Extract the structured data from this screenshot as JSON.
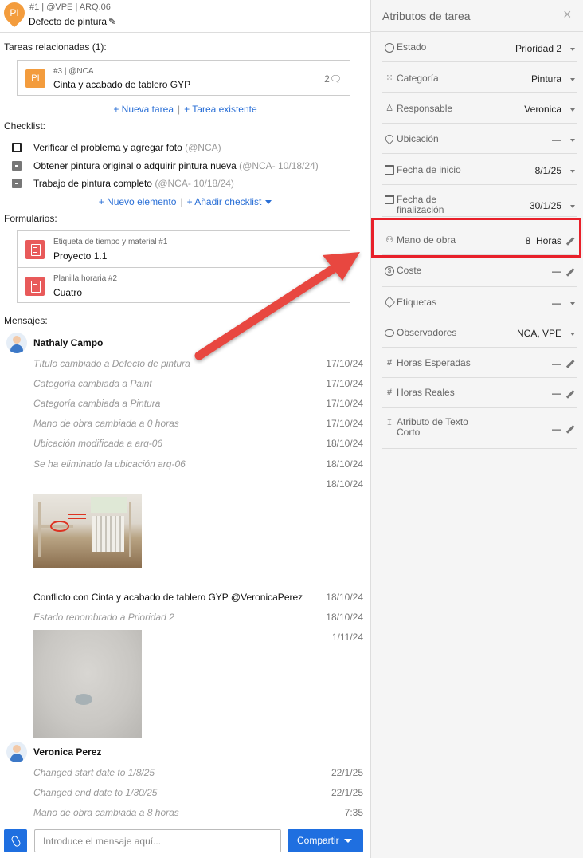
{
  "task": {
    "badge": "PI",
    "meta": "#1 | @VPE | ARQ.06",
    "title": "Defecto de pintura"
  },
  "related": {
    "label": "Tareas relacionadas (1):",
    "items": [
      {
        "badge": "PI",
        "meta": "#3 | @NCA",
        "name": "Cinta y acabado de tablero GYP",
        "comments": "2"
      }
    ],
    "new_task": "+ Nueva tarea",
    "existing_task": "+ Tarea existente"
  },
  "checklist": {
    "label": "Checklist:",
    "items": [
      {
        "text": "Verificar el problema y agregar foto",
        "note": "(@NCA)",
        "state": "unchecked"
      },
      {
        "text": "Obtener pintura original o adquirir pintura nueva",
        "note": "(@NCA- 10/18/24)",
        "state": "partial"
      },
      {
        "text": "Trabajo de pintura completo",
        "note": "(@NCA- 10/18/24)",
        "state": "partial"
      }
    ],
    "new_item": "+ Nuevo elemento",
    "add_checklist": "+ Añadir checklist"
  },
  "forms": {
    "label": "Formularios:",
    "items": [
      {
        "label": "Etiqueta de tiempo y material #1",
        "value": "Proyecto 1.1"
      },
      {
        "label": "Planilla horaria #2",
        "value": "Cuatro"
      }
    ]
  },
  "messages": {
    "label": "Mensajes:",
    "groups": [
      {
        "author": "Nathaly Campo",
        "entries": [
          {
            "text": "Título cambiado a Defecto de pintura",
            "date": "17/10/24"
          },
          {
            "text": "Categoría cambiada a Paint",
            "date": "17/10/24"
          },
          {
            "text": "Categoría cambiada a Pintura",
            "date": "17/10/24"
          },
          {
            "text": "Mano de obra cambiada a 0 horas",
            "date": "17/10/24"
          },
          {
            "text": "Ubicación modificada a arq-06",
            "date": "18/10/24"
          },
          {
            "text": "Se ha eliminado la ubicación arq-06",
            "date": "18/10/24"
          },
          {
            "text": "",
            "date": "18/10/24"
          },
          {
            "text": "Conflicto con Cinta y acabado de tablero GYP @VeronicaPerez",
            "date": "18/10/24"
          },
          {
            "text": "Estado renombrado a Prioridad 2",
            "date": "18/10/24"
          },
          {
            "text": "",
            "date": "1/11/24"
          }
        ]
      },
      {
        "author": "Veronica Perez",
        "entries": [
          {
            "text": "Changed start date to 1/8/25",
            "date": "22/1/25"
          },
          {
            "text": "Changed end date to 1/30/25",
            "date": "22/1/25"
          },
          {
            "text": "Mano de obra cambiada a 8 horas",
            "date": "7:35"
          }
        ]
      }
    ]
  },
  "composer": {
    "placeholder": "Introduce el mensaje aquí...",
    "share": "Compartir"
  },
  "attributes": {
    "title": "Atributos de tarea",
    "close": "×",
    "rows": [
      {
        "icon": "status-icon",
        "name": "Estado",
        "value": "Prioridad 2",
        "control": "dropdown"
      },
      {
        "icon": "category-icon",
        "name": "Categoría",
        "value": "Pintura",
        "control": "dropdown"
      },
      {
        "icon": "person-icon",
        "name": "Responsable",
        "value": "Veronica",
        "control": "dropdown"
      },
      {
        "icon": "location-icon",
        "name": "Ubicación",
        "value": "—",
        "control": "dropdown"
      },
      {
        "icon": "calendar-icon",
        "name": "Fecha de inicio",
        "value": "8/1/25",
        "control": "dropdown"
      },
      {
        "icon": "calendar-icon",
        "name": "Fecha de finalización",
        "value": "30/1/25",
        "control": "dropdown"
      },
      {
        "icon": "group-icon",
        "name": "Mano de obra",
        "value": "8  Horas",
        "control": "edit"
      },
      {
        "icon": "dollar-icon",
        "name": "Coste",
        "value": "—",
        "control": "edit"
      },
      {
        "icon": "tag-icon",
        "name": "Etiquetas",
        "value": "—",
        "control": "dropdown"
      },
      {
        "icon": "eye-icon",
        "name": "Observadores",
        "value": "NCA, VPE",
        "control": "dropdown"
      },
      {
        "icon": "hash-icon",
        "name": "Horas Esperadas",
        "value": "—",
        "control": "edit"
      },
      {
        "icon": "hash-icon",
        "name": "Horas Reales",
        "value": "—",
        "control": "edit"
      },
      {
        "icon": "text-field-icon",
        "name": "Atributo de Texto Corto",
        "value": "—",
        "control": "edit"
      }
    ]
  },
  "colors": {
    "accent_blue": "#1f6fe0",
    "link_blue": "#2a6fd6",
    "task_orange": "#f39c3d",
    "form_red": "#e85a5a",
    "highlight_red": "#e8202a"
  }
}
